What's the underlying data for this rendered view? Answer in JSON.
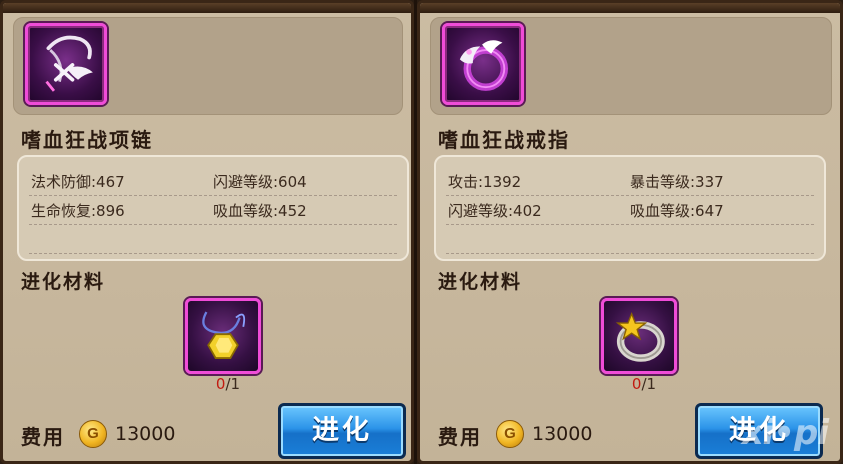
{
  "panels": [
    {
      "icon": "bloodthirst-necklace-icon",
      "name": "嗜血狂战项链",
      "stats": [
        [
          "法术防御:467",
          "闪避等级:604"
        ],
        [
          "生命恢复:896",
          "吸血等级:452"
        ]
      ],
      "material_title": "进化材料",
      "material_icon": "yellow-gem-pendant-icon",
      "material_have": "0",
      "material_sep": "/",
      "material_need": "1",
      "cost_label": "费用",
      "coin_symbol": "G",
      "cost_value": "13000",
      "button_label": "进化"
    },
    {
      "icon": "bloodthirst-ring-icon",
      "name": "嗜血狂战戒指",
      "stats": [
        [
          "攻击:1392",
          "暴击等级:337"
        ],
        [
          "闪避等级:402",
          "吸血等级:647"
        ]
      ],
      "material_title": "进化材料",
      "material_icon": "gold-star-ring-icon",
      "material_have": "0",
      "material_sep": "/",
      "material_need": "1",
      "cost_label": "费用",
      "coin_symbol": "G",
      "cost_value": "13000",
      "button_label": "进化"
    }
  ],
  "watermark": "xi•pi",
  "colors": {
    "panel_bg": "#c7b79d",
    "rarity_border": "#f04cd8",
    "button_blue": "#2b93e8",
    "count_red": "#c21a10"
  }
}
